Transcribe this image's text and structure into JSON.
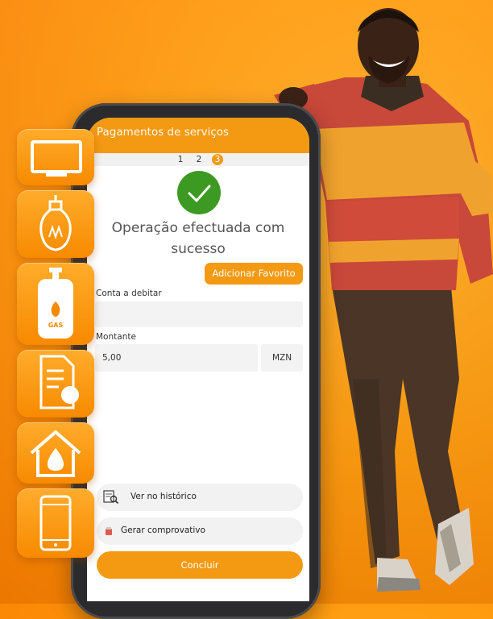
{
  "screen": {
    "title": "Pagamentos de serviços",
    "steps": [
      "1",
      "2",
      "3"
    ],
    "active_step": 3,
    "message_line1": "Operação efectuada com",
    "message_line2": "sucesso",
    "favorite_button": "Adicionar Favorito",
    "account_label": "Conta a debitar",
    "account_value": "",
    "amount_label": "Montante",
    "amount_value": "5,00",
    "currency": "MZN",
    "history_label": "Ver no histórico",
    "receipt_label": "Gerar comprovativo",
    "conclude_button": "Concluir"
  },
  "services": [
    {
      "icon": "tv-icon"
    },
    {
      "icon": "lightbulb-icon"
    },
    {
      "icon": "gas-cylinder-icon",
      "label": "GAS"
    },
    {
      "icon": "bill-document-icon"
    },
    {
      "icon": "water-house-icon"
    },
    {
      "icon": "mobile-phone-icon"
    }
  ],
  "colors": {
    "accent": "#f39a12",
    "background": "#ff9a0d",
    "success": "#3c9a22"
  }
}
